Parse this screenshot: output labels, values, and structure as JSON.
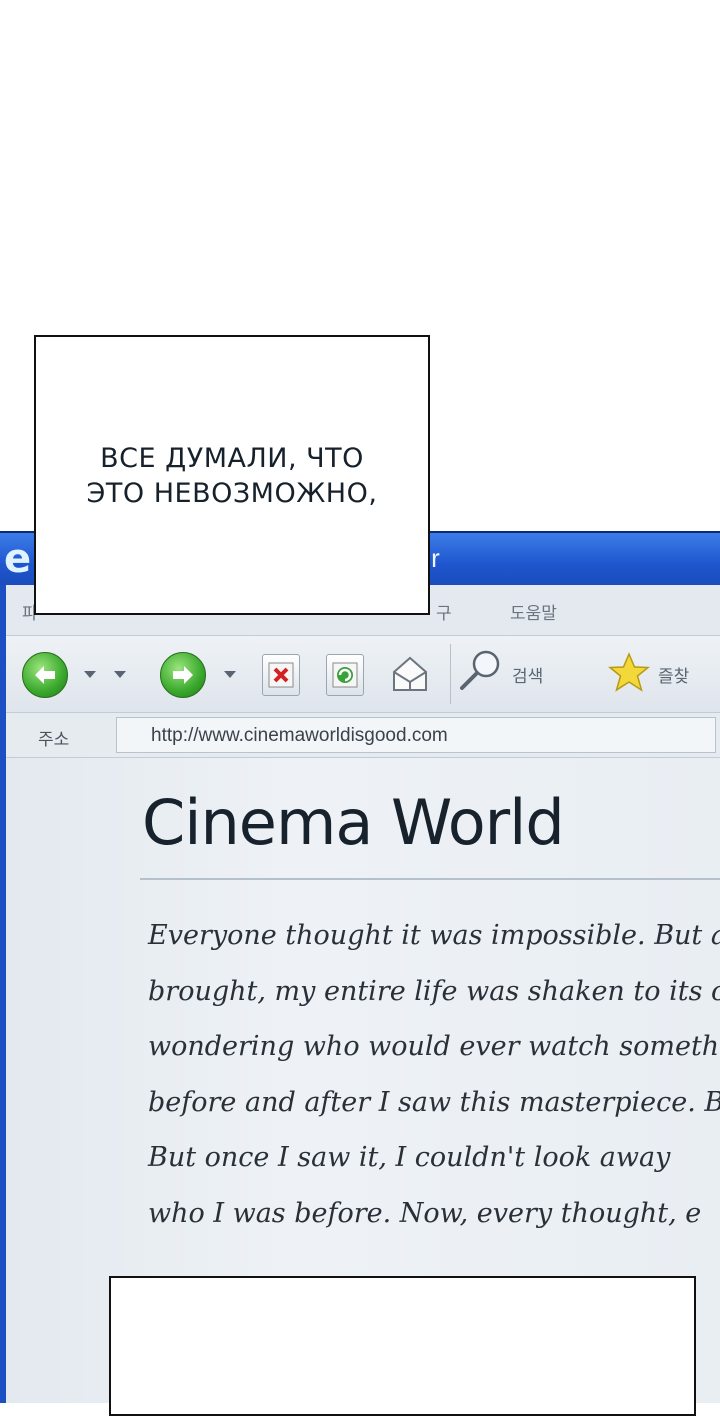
{
  "caption": {
    "lines": [
      "ВСЕ ДУМАЛИ, ЧТО",
      "ЭТО НЕВОЗМОЖНО,"
    ]
  },
  "browser": {
    "logo": "e",
    "title_fragment": "orer",
    "menu": {
      "items": [
        "파",
        "도움말",
        "구"
      ]
    },
    "toolbar": {
      "search_label": "검색",
      "favorites_label": "즐찾"
    },
    "address": {
      "label": "주소",
      "url": "http://www.cinemaworldisgood.com"
    }
  },
  "page": {
    "title": "Cinema World",
    "review_lines": [
      "Everyone thought it was impossible. But a",
      "brought, my entire life was shaken to its core.",
      "wondering who would ever watch something s",
      "before and after I saw this masterpiece. B",
      "But once I saw it, I couldn't look away",
      "who I was before. Now, every thought, e"
    ]
  },
  "colors": {
    "titlebar": "#1f56cf",
    "browser_frame": "#1d4fc4",
    "page_bg": "#eaeef3",
    "caption_text": "#16212b"
  }
}
